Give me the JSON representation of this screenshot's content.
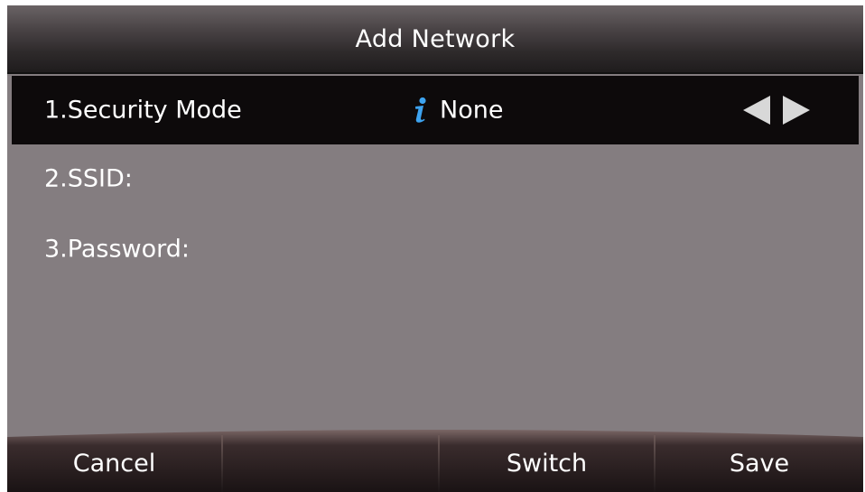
{
  "title": "Add Network",
  "rows": [
    {
      "label": "1.Security Mode",
      "value": "None",
      "icon": "info-icon",
      "selected": true
    },
    {
      "label": "2.SSID:"
    },
    {
      "label": "3.Password:"
    }
  ],
  "softkeys": [
    "Cancel",
    "",
    "Switch",
    "Save"
  ],
  "colors": {
    "background": "#847d80",
    "selected_row": "#0d0a0b",
    "info_icon": "#3da3f0",
    "text": "#ffffff"
  }
}
